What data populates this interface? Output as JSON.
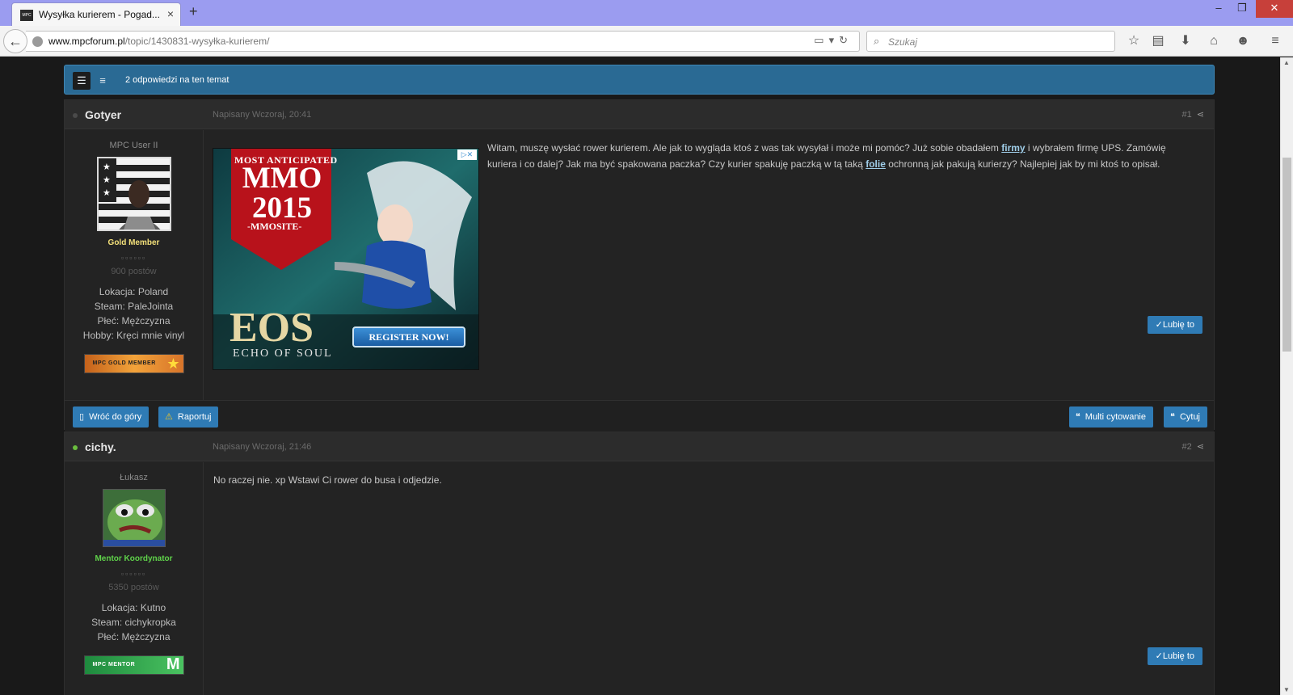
{
  "browser": {
    "tab_title": "Wysyłka kurierem - Pogad...",
    "tab_favicon_text": "MPC",
    "tab_close_glyph": "×",
    "new_tab_glyph": "+",
    "url_domain": "www.mpcforum.pl",
    "url_path": "/topic/1430831-wysyłka-kurierem/",
    "search_placeholder": "Szukaj",
    "window_buttons": {
      "minimize": "–",
      "restore": "❐",
      "close": "✕"
    },
    "toolbar_icons": [
      "star-icon",
      "reading-list-icon",
      "download-icon",
      "home-icon",
      "chat-icon",
      "menu-icon"
    ]
  },
  "topic_bar": {
    "reply_count": "2 odpowiedzi na ten temat"
  },
  "posts": [
    {
      "author": "Gotyer",
      "online": false,
      "date": "Napisany Wczoraj, 20:41",
      "number": "#1",
      "user_title": "MPC User II",
      "group": "Gold Member",
      "group_color": "#f3e07a",
      "pips": "▫▫▫▫▫▫",
      "postcount": "900 postów",
      "info": [
        "Lokacja: Poland",
        "Steam: PaleJointa",
        "Płeć: Mężczyzna",
        "Hobby: Kręci mnie vinyl"
      ],
      "badge_text": "MPC GOLD MEMBER",
      "body_parts": [
        "Witam, muszę wysłać rower kurierem. Ale jak to wygląda ktoś z was tak wysyłał i może mi pomóc? Już sobie obadałem ",
        "firmy",
        " i wybrałem firmę UPS. Zamówię",
        "kuriera i co dalej? Jak ma być spakowana paczka? Czy kurier spakuję paczką w tą taką ",
        "folie",
        " ochronną jak pakują kurierzy?  Najlepiej jak by mi ktoś to opisał."
      ],
      "like_label": "✓Lubię to"
    },
    {
      "author": "cichy.",
      "online": true,
      "date": "Napisany Wczoraj, 21:46",
      "number": "#2",
      "user_title": "Łukasz",
      "group": "Mentor Koordynator",
      "group_color": "#5fd34a",
      "pips": "▫▫▫▫▫▫",
      "postcount": "5350 postów",
      "info": [
        "Lokacja: Kutno",
        "Steam: cichykropka",
        "Płeć: Mężczyzna"
      ],
      "badge_text": "MPC MENTOR",
      "body_parts": [
        "No raczej nie. xp Wstawi Ci rower do busa i odjedzie."
      ],
      "like_label": "✓Lubię to"
    }
  ],
  "ad": {
    "line1": "MOST ANTICIPATED",
    "line2": "MMO 2015",
    "line3": "-MMOSITE-",
    "logo": "EOS",
    "logo_sub": "ECHO OF SOUL",
    "cta": "REGISTER NOW!",
    "close_glyphs": "▷✕"
  },
  "post_footer": {
    "back_to_top": "Wróć do góry",
    "report": "Raportuj",
    "multi_quote": "Multi cytowanie",
    "quote": "Cytuj"
  },
  "colors": {
    "accent": "#2f7bb5",
    "topic_bar": "#2a6a94",
    "page_bg": "#191919",
    "post_bg": "#232323"
  }
}
